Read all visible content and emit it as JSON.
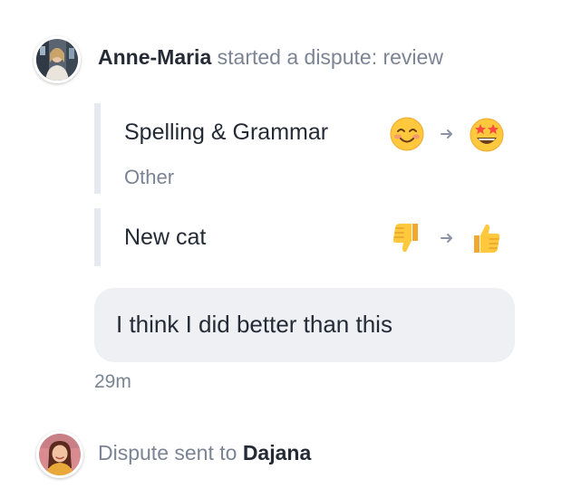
{
  "event_started": {
    "actor": "Anne-Maria",
    "action": "started a dispute: review"
  },
  "ratings": [
    {
      "category": "Spelling & Grammar",
      "subtitle": "Other",
      "from_icon": "smiling-face-icon",
      "to_icon": "star-struck-face-icon"
    },
    {
      "category": "New cat",
      "from_icon": "thumbs-down-icon",
      "to_icon": "thumbs-up-icon"
    }
  ],
  "comment": {
    "text": "I think I did better than this",
    "time": "29m"
  },
  "event_sent": {
    "action": "Dispute sent to",
    "recipient": "Dajana"
  },
  "colors": {
    "muted_text": "#7b8494",
    "strong_text": "#252b36",
    "block_border": "#e6e9ef",
    "bubble_bg": "#eef0f4",
    "emoji_yellow": "#ffc83d"
  }
}
